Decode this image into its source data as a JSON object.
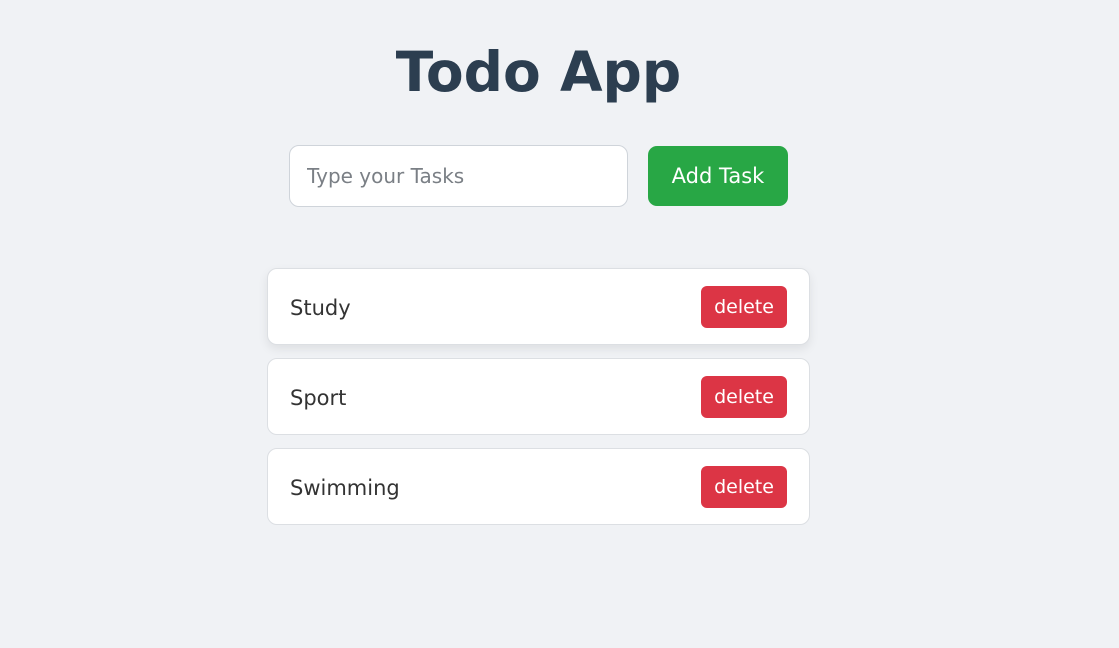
{
  "app": {
    "title": "Todo App"
  },
  "input": {
    "placeholder": "Type your Tasks",
    "value": ""
  },
  "add_button": {
    "label": "Add Task"
  },
  "tasks": [
    {
      "text": "Study",
      "delete_label": "delete"
    },
    {
      "text": "Sport",
      "delete_label": "delete"
    },
    {
      "text": "Swimming",
      "delete_label": "delete"
    }
  ],
  "colors": {
    "background": "#f0f2f5",
    "title": "#2c3e50",
    "add_button": "#28a745",
    "delete_button": "#dc3545"
  }
}
